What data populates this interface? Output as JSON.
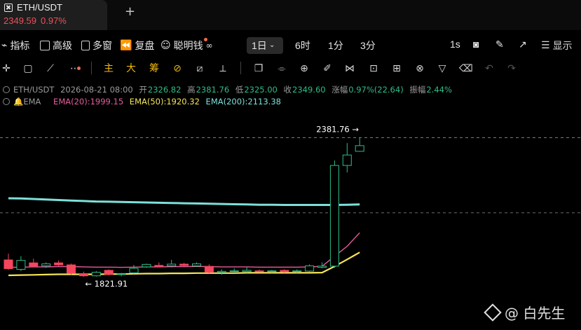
{
  "tab": {
    "symbol": "ETH/USDT",
    "price": "2349.59",
    "change": "0.97%"
  },
  "toolbar": {
    "indicators": "指标",
    "advanced": "高级",
    "multi_window": "多窗",
    "replay": "复盘",
    "smart_money": "聪明钱",
    "display": "显示",
    "timeframes": [
      "1日",
      "6时",
      "1分",
      "3分"
    ],
    "tick": "1s"
  },
  "drawing_tools": [
    "主",
    "大",
    "筹"
  ],
  "legend": {
    "symbol": "ETH/USDT",
    "datetime": "2026-08-21 08:00",
    "open_label": "开",
    "open": "2326.82",
    "high_label": "高",
    "high": "2381.76",
    "low_label": "低",
    "low": "2325.00",
    "close_label": "收",
    "close": "2349.60",
    "change_label": "涨幅",
    "change": "0.97%(22.64)",
    "amp_label": "振幅",
    "amp": "2.44%",
    "ema_label": "EMA",
    "ema20": "EMA(20):1999.15",
    "ema50": "EMA(50):1920.32",
    "ema200": "EMA(200):2113.38"
  },
  "annotations": {
    "high_marker": "2381.76 →",
    "low_marker": "← 1821.91"
  },
  "colors": {
    "up": "#2ebd85",
    "down": "#f6465d",
    "ema20": "#e25d9b",
    "ema50": "#f5e55a",
    "ema200": "#7de0d8"
  },
  "watermark": "@ 白先生",
  "chart_data": {
    "type": "candlestick",
    "price_scale": {
      "min": 1780,
      "max": 2400
    },
    "candles": [
      {
        "o": 1890,
        "h": 1915,
        "l": 1850,
        "c": 1855
      },
      {
        "o": 1852,
        "h": 1905,
        "l": 1845,
        "c": 1888
      },
      {
        "o": 1878,
        "h": 1895,
        "l": 1860,
        "c": 1865
      },
      {
        "o": 1866,
        "h": 1880,
        "l": 1858,
        "c": 1874
      },
      {
        "o": 1878,
        "h": 1888,
        "l": 1866,
        "c": 1870
      },
      {
        "o": 1870,
        "h": 1875,
        "l": 1830,
        "c": 1836
      },
      {
        "o": 1835,
        "h": 1843,
        "l": 1822,
        "c": 1826
      },
      {
        "o": 1826,
        "h": 1845,
        "l": 1823,
        "c": 1840
      },
      {
        "o": 1848,
        "h": 1852,
        "l": 1828,
        "c": 1832
      },
      {
        "o": 1832,
        "h": 1838,
        "l": 1824,
        "c": 1834
      },
      {
        "o": 1838,
        "h": 1870,
        "l": 1834,
        "c": 1856
      },
      {
        "o": 1862,
        "h": 1875,
        "l": 1858,
        "c": 1872
      },
      {
        "o": 1868,
        "h": 1880,
        "l": 1860,
        "c": 1864
      },
      {
        "o": 1866,
        "h": 1890,
        "l": 1860,
        "c": 1873
      },
      {
        "o": 1873,
        "h": 1878,
        "l": 1864,
        "c": 1868
      },
      {
        "o": 1866,
        "h": 1880,
        "l": 1862,
        "c": 1874
      },
      {
        "o": 1864,
        "h": 1872,
        "l": 1836,
        "c": 1840
      },
      {
        "o": 1840,
        "h": 1852,
        "l": 1830,
        "c": 1844
      },
      {
        "o": 1844,
        "h": 1856,
        "l": 1838,
        "c": 1846
      },
      {
        "o": 1843,
        "h": 1862,
        "l": 1838,
        "c": 1848
      },
      {
        "o": 1846,
        "h": 1852,
        "l": 1840,
        "c": 1842
      },
      {
        "o": 1844,
        "h": 1850,
        "l": 1838,
        "c": 1846
      },
      {
        "o": 1848,
        "h": 1852,
        "l": 1838,
        "c": 1842
      },
      {
        "o": 1845,
        "h": 1852,
        "l": 1838,
        "c": 1846
      },
      {
        "o": 1845,
        "h": 1872,
        "l": 1840,
        "c": 1866
      },
      {
        "o": 1860,
        "h": 1880,
        "l": 1856,
        "c": 1865
      },
      {
        "o": 1865,
        "h": 2290,
        "l": 1858,
        "c": 2270
      },
      {
        "o": 2270,
        "h": 2360,
        "l": 2242,
        "c": 2312
      },
      {
        "o": 2326.82,
        "h": 2381.76,
        "l": 2325.0,
        "c": 2349.6
      }
    ],
    "ema20": [
      1860,
      1861,
      1862,
      1862,
      1863,
      1863,
      1862,
      1861,
      1861,
      1860,
      1861,
      1862,
      1862,
      1863,
      1863,
      1864,
      1863,
      1862,
      1862,
      1862,
      1861,
      1861,
      1861,
      1861,
      1862,
      1864,
      1905,
      1945,
      1999.15
    ],
    "ema50": [
      1828,
      1829,
      1830,
      1831,
      1832,
      1832,
      1832,
      1832,
      1833,
      1833,
      1834,
      1835,
      1835,
      1836,
      1836,
      1837,
      1837,
      1837,
      1837,
      1838,
      1838,
      1838,
      1838,
      1838,
      1838,
      1839,
      1864,
      1892,
      1920.32
    ],
    "ema200": [
      2138,
      2137,
      2135,
      2133,
      2131,
      2129,
      2127,
      2125,
      2124,
      2123,
      2122,
      2121,
      2120,
      2119,
      2118,
      2117,
      2116,
      2115,
      2114,
      2113,
      2112,
      2112,
      2111,
      2111,
      2111,
      2111,
      2111,
      2112,
      2113.38
    ],
    "high_line": 2381.76,
    "ref_line": 2113.38,
    "high_label": "2381.76",
    "low_label": "1821.91"
  }
}
